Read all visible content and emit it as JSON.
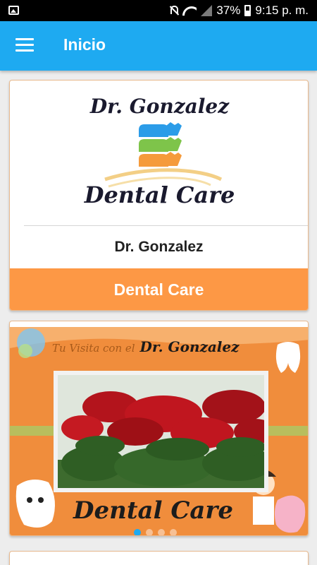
{
  "status_bar": {
    "battery": "37%",
    "time": "9:15 p. m."
  },
  "app_bar": {
    "title": "Inicio"
  },
  "card1": {
    "logo_line1": "Dr. Gonzalez",
    "logo_line2": "Dental Care",
    "title": "Dr. Gonzalez",
    "footer": "Dental Care"
  },
  "card2": {
    "banner_prefix": "Tu Visita con el",
    "banner_name": "Dr. Gonzalez",
    "banner_bottom": "Dental Care",
    "carousel": {
      "total": 4,
      "active": 1
    }
  },
  "colors": {
    "primary": "#1eaaf1",
    "accent": "#fd9845"
  }
}
